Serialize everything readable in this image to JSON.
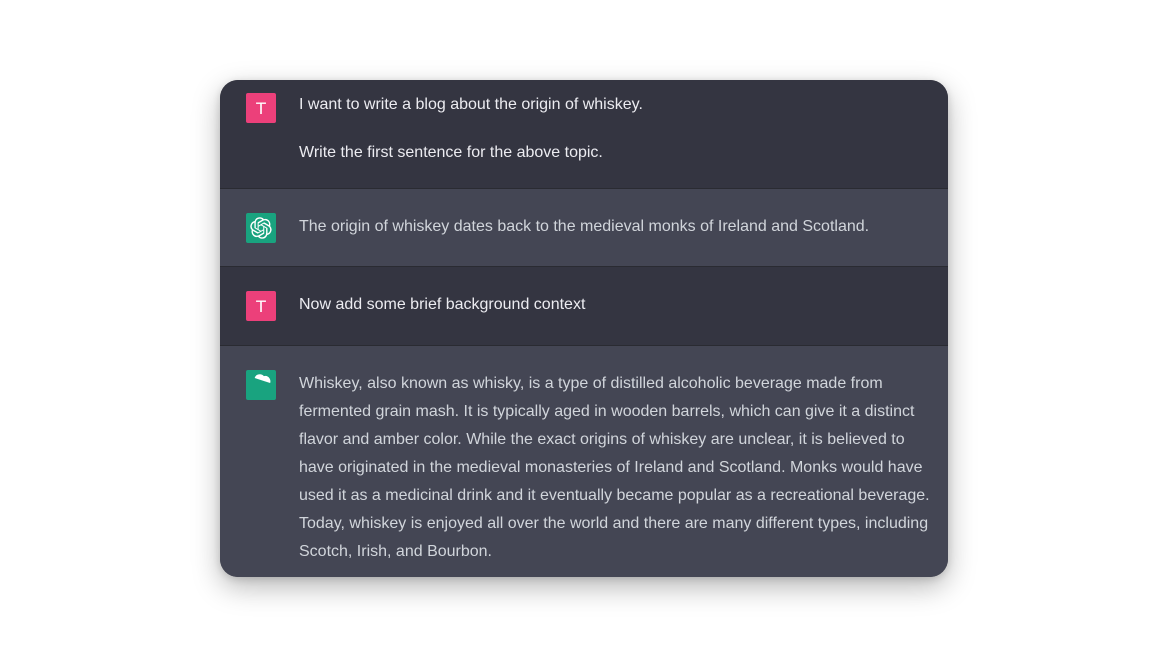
{
  "conversation": [
    {
      "role": "user",
      "avatar_letter": "T",
      "avatar_color": "#ec407a",
      "paragraphs": [
        "I want to write a blog about the origin of whiskey.",
        "Write the first sentence for the above topic."
      ]
    },
    {
      "role": "assistant",
      "avatar_icon": "openai-logo-icon",
      "avatar_color": "#19a37f",
      "paragraphs": [
        "The origin of whiskey dates back to the medieval monks of Ireland and Scotland."
      ]
    },
    {
      "role": "user",
      "avatar_letter": "T",
      "avatar_color": "#ec407a",
      "paragraphs": [
        "Now add some brief background context"
      ]
    },
    {
      "role": "assistant",
      "avatar_icon": "openai-logo-icon",
      "avatar_color": "#19a37f",
      "paragraphs": [
        "Whiskey, also known as whisky, is a type of distilled alcoholic beverage made from fermented grain mash. It is typically aged in wooden barrels, which can give it a distinct flavor and amber color. While the exact origins of whiskey are unclear, it is believed to have originated in the medieval monasteries of Ireland and Scotland. Monks would have used it as a medicinal drink and it eventually became popular as a recreational beverage. Today, whiskey is enjoyed all over the world and there are many different types, including Scotch, Irish, and Bourbon."
      ]
    }
  ],
  "colors": {
    "user_row_bg": "#343541",
    "assistant_row_bg": "#444654",
    "user_text": "#ececf1",
    "assistant_text": "#d1d5db"
  }
}
